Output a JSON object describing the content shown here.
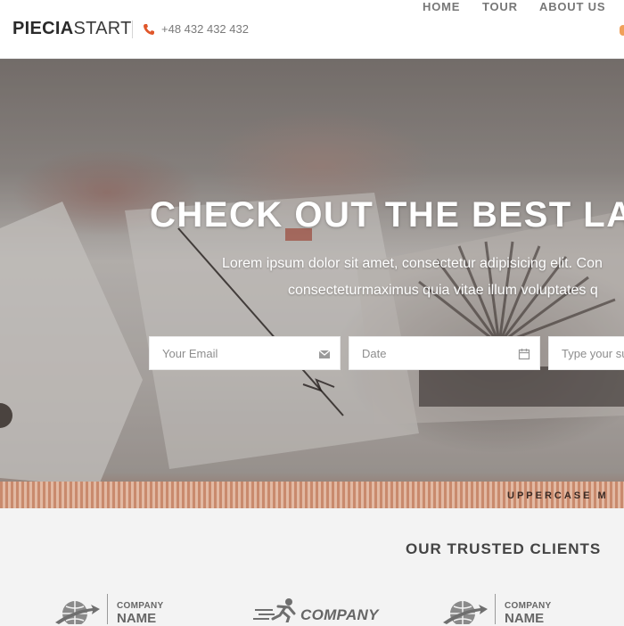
{
  "header": {
    "logo_bold": "PIECIA",
    "logo_light": "START",
    "phone": "+48 432 432 432",
    "nav": [
      "HOME",
      "TOUR",
      "ABOUT US"
    ]
  },
  "hero": {
    "title": "CHECK OUT THE BEST LAN",
    "subtitle_line1": "Lorem ipsum dolor sit amet, consectetur adipisicing elit. Con",
    "subtitle_line2": "consecteturmaximus quia vitae illum voluptates q",
    "fields": {
      "email_placeholder": "Your Email",
      "date_placeholder": "Date",
      "subject_placeholder": "Type your su"
    },
    "stripe_text": "UPPERCASE M"
  },
  "clients": {
    "title": "OUR TRUSTED CLIENTS",
    "logos": [
      {
        "line1": "COMPANY",
        "line2": "NAME"
      },
      {
        "name": "COMPANY"
      },
      {
        "line1": "COMPANY",
        "line2": "NAME"
      }
    ]
  },
  "colors": {
    "accent": "#e0572b",
    "text_dark": "#2a2a2a",
    "nav_text": "#777777",
    "section_bg": "#f3f3f3"
  },
  "icons": {
    "phone": "phone-icon",
    "email": "envelope-icon",
    "date": "calendar-icon"
  }
}
